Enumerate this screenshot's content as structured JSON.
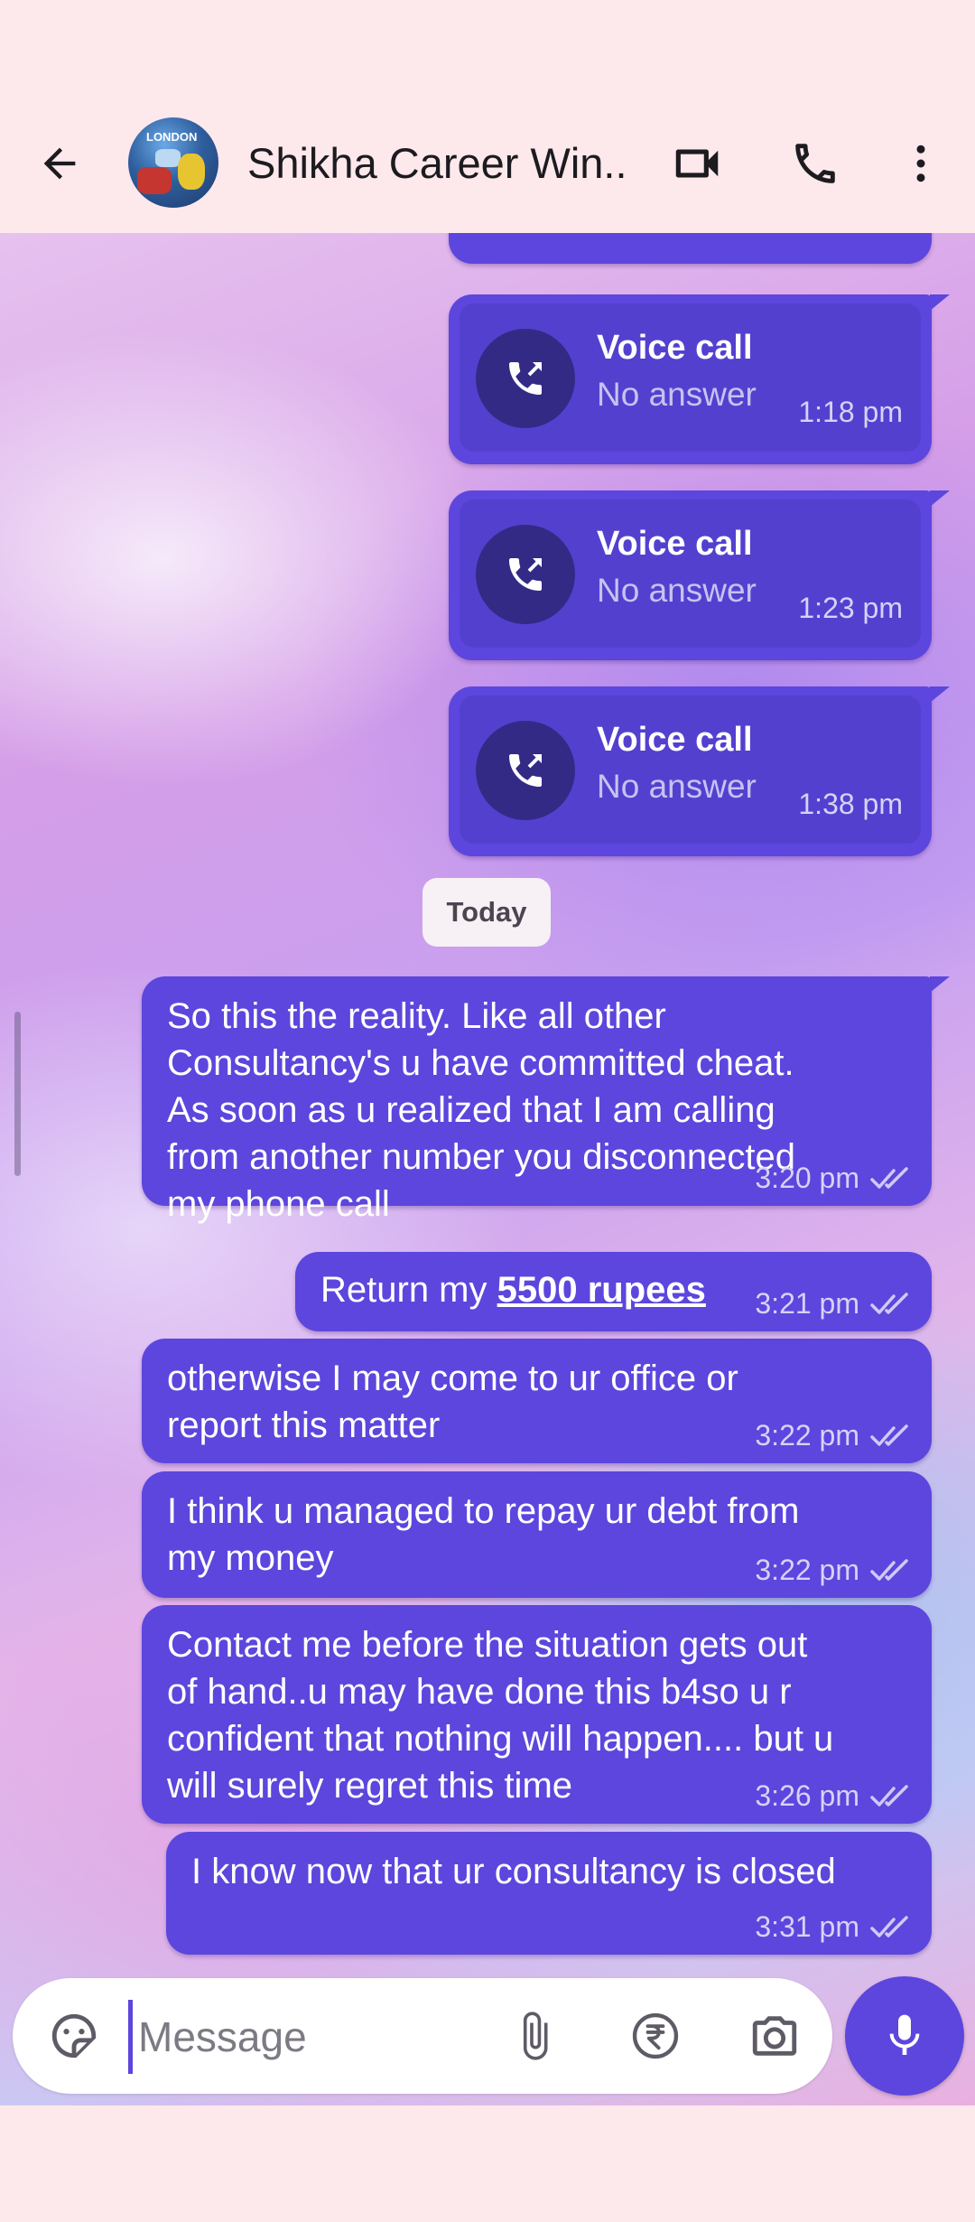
{
  "header": {
    "contact_name": "Shikha Career Win...",
    "avatar_caption": "LONDON",
    "icons": {
      "back": "arrow-back-icon",
      "video": "videocam-icon",
      "call": "phone-icon",
      "menu": "more-vert-icon"
    }
  },
  "colors": {
    "bubble": "#5c46dd",
    "background": "#fde8ec",
    "call_circle": "#332a86"
  },
  "calls": [
    {
      "title": "Voice call",
      "status": "No answer",
      "time": "1:18 pm"
    },
    {
      "title": "Voice call",
      "status": "No answer",
      "time": "1:23 pm"
    },
    {
      "title": "Voice call",
      "status": "No answer",
      "time": "1:38 pm"
    }
  ],
  "date_divider": "Today",
  "messages": [
    {
      "lines": [
        "So this the reality. Like all other",
        "Consultancy's u have committed cheat.",
        "As soon as u realized that I am calling",
        "from another number you disconnected",
        "my phone call"
      ],
      "time": "3:20 pm"
    },
    {
      "prefix": "Return my ",
      "link": "5500 rupees",
      "time": "3:21 pm"
    },
    {
      "lines": [
        "otherwise I may come to ur office or",
        "report this matter"
      ],
      "time": "3:22 pm"
    },
    {
      "lines": [
        "I think u managed to repay ur debt from",
        "my money"
      ],
      "time": "3:22 pm"
    },
    {
      "lines": [
        "Contact me before the situation gets out",
        "of hand..u may have done this b4so u r",
        "confident that nothing will happen.... but u",
        "will surely regret this time"
      ],
      "time": "3:26 pm"
    },
    {
      "lines": [
        "I know now that ur consultancy is closed"
      ],
      "time": "3:31 pm"
    }
  ],
  "composer": {
    "placeholder": "Message",
    "icons": [
      "sticker-icon",
      "attach-icon",
      "rupee-payment-icon",
      "camera-icon",
      "mic-icon"
    ]
  }
}
